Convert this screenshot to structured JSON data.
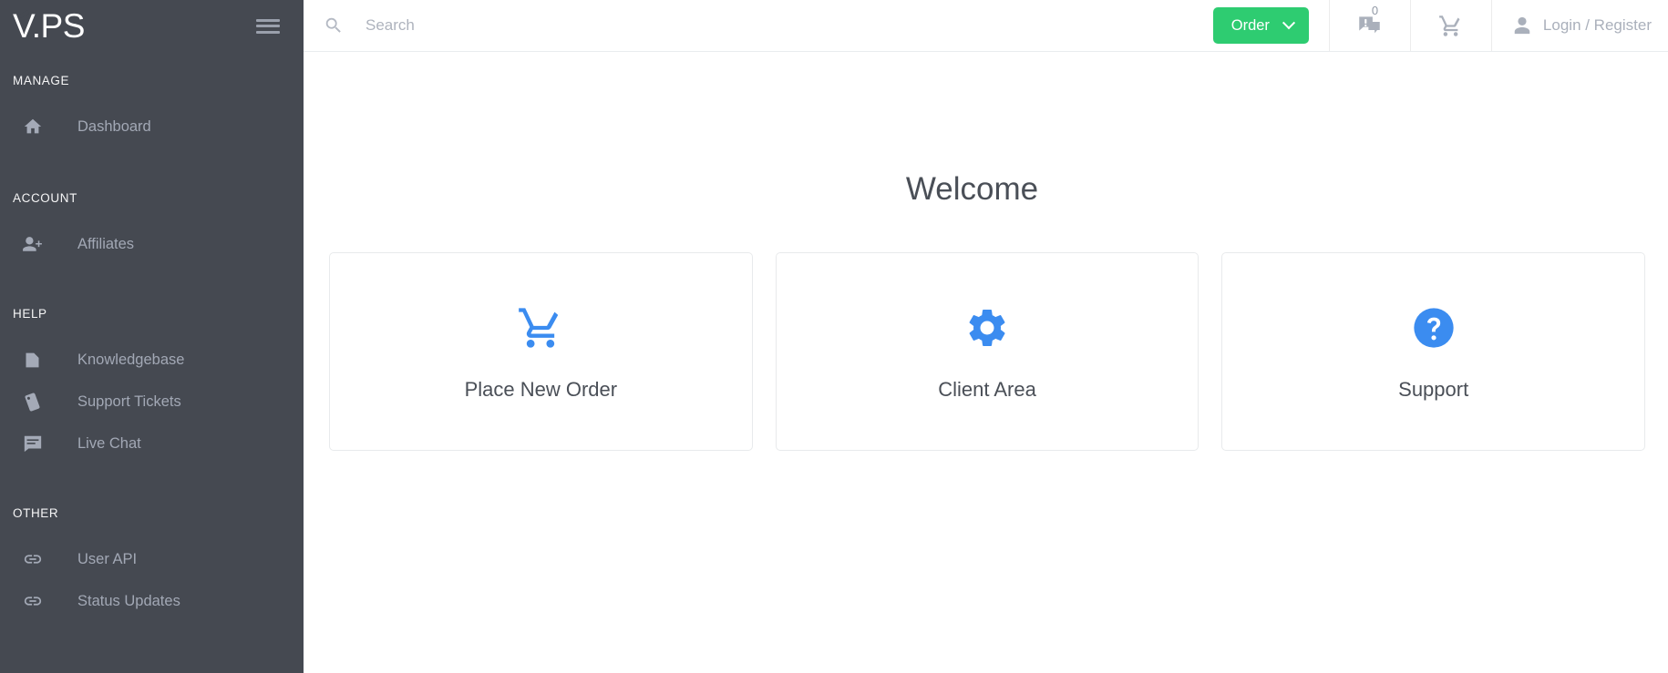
{
  "brand": {
    "logo_text": "V.PS",
    "menu_toggle_name": "hamburger-menu"
  },
  "sidebar": {
    "groups": [
      {
        "title": "MANAGE",
        "items": [
          {
            "label": "Dashboard",
            "icon": "home-icon"
          }
        ]
      },
      {
        "title": "ACCOUNT",
        "items": [
          {
            "label": "Affiliates",
            "icon": "person-add-icon"
          }
        ]
      },
      {
        "title": "HELP",
        "items": [
          {
            "label": "Knowledgebase",
            "icon": "document-icon"
          },
          {
            "label": "Support Tickets",
            "icon": "ticket-icon"
          },
          {
            "label": "Live Chat",
            "icon": "chat-bubble-icon"
          }
        ]
      },
      {
        "title": "OTHER",
        "items": [
          {
            "label": "User API",
            "icon": "link-icon"
          },
          {
            "label": "Status Updates",
            "icon": "link-icon"
          }
        ]
      }
    ]
  },
  "header": {
    "search_placeholder": "Search",
    "search_value": "",
    "search_icon": "search-icon",
    "order_button": {
      "label": "Order",
      "color": "#2ecc71",
      "chevron": "chevron-down-icon"
    },
    "announcements": {
      "icon": "announcement-icon",
      "count": "0"
    },
    "cart": {
      "icon": "shopping-cart-icon"
    },
    "account": {
      "icon": "person-icon",
      "label": "Login / Register"
    }
  },
  "main": {
    "title": "Welcome",
    "cards": [
      {
        "label": "Place New Order",
        "icon": "shopping-cart-icon",
        "color": "#3b8cf0"
      },
      {
        "label": "Client Area",
        "icon": "gear-icon",
        "color": "#3b8cf0"
      },
      {
        "label": "Support",
        "icon": "help-circle-icon",
        "color": "#3b8cf0"
      }
    ]
  },
  "colors": {
    "sidebar_bg": "#454951",
    "accent_green": "#2ecc71",
    "accent_blue": "#3b8cf0",
    "text_dark": "#4a4f57",
    "text_muted": "#a2a8b5"
  }
}
